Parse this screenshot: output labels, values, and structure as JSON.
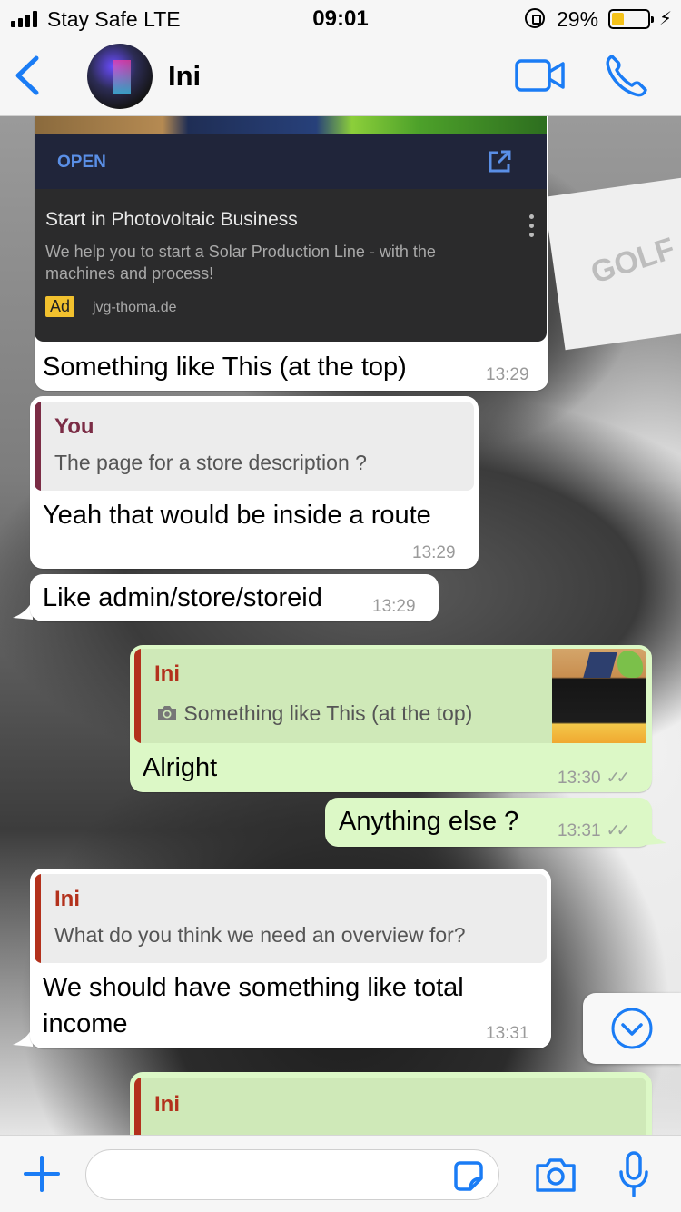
{
  "status_bar": {
    "carrier": "Stay Safe  LTE",
    "time": "09:01",
    "battery_percent": "29%",
    "battery_level": 0.29
  },
  "header": {
    "contact_name": "Ini",
    "icons": [
      "back-chevron-icon",
      "video-call-icon",
      "phone-icon"
    ]
  },
  "colors": {
    "accent": "#1a7cf5",
    "incoming_bubble": "#ffffff",
    "outgoing_bubble": "#dcf8c6",
    "quote_you": "#7b2c45",
    "quote_ini": "#b3311c"
  },
  "ad": {
    "open_label": "OPEN",
    "title": "Start in Photovoltaic Business",
    "description": "We help you to start a Solar Production Line - with the machines and process!",
    "badge": "Ad",
    "domain": "jvg-thoma.de"
  },
  "messages": [
    {
      "text": "Something like This (at the top)",
      "time": "13:29"
    },
    {
      "quote_name": "You",
      "quote_text": "The page for a store description ?",
      "text": "Yeah that would be inside a route",
      "time": "13:29"
    },
    {
      "text": "Like admin/store/storeid",
      "time": "13:29"
    },
    {
      "quote_name": "Ini",
      "quote_text": "Something like This (at the top)",
      "text": "Alright",
      "time": "13:30"
    },
    {
      "text": "Anything else ?",
      "time": "13:31"
    },
    {
      "quote_name": "Ini",
      "quote_text": "What do you think we need an overview for?",
      "text_line1": "We should have something like total",
      "text_line2": "income",
      "time": "13:31"
    },
    {
      "quote_name": "Ini"
    }
  ],
  "input": {
    "placeholder": "",
    "value": ""
  }
}
